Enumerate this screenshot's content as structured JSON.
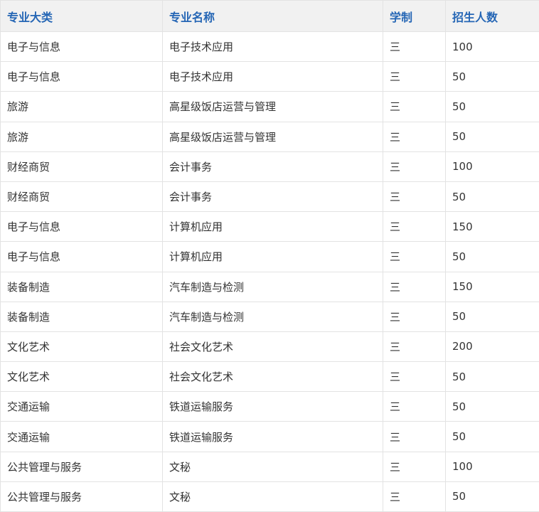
{
  "table": {
    "headers": [
      "专业大类",
      "专业名称",
      "学制",
      "招生人数"
    ],
    "rows": [
      [
        "电子与信息",
        "电子技术应用",
        "三",
        "100"
      ],
      [
        "电子与信息",
        "电子技术应用",
        "三",
        "50"
      ],
      [
        "旅游",
        "高星级饭店运营与管理",
        "三",
        "50"
      ],
      [
        "旅游",
        "高星级饭店运营与管理",
        "三",
        "50"
      ],
      [
        "财经商贸",
        "会计事务",
        "三",
        "100"
      ],
      [
        "财经商贸",
        "会计事务",
        "三",
        "50"
      ],
      [
        "电子与信息",
        "计算机应用",
        "三",
        "150"
      ],
      [
        "电子与信息",
        "计算机应用",
        "三",
        "50"
      ],
      [
        "装备制造",
        "汽车制造与检测",
        "三",
        "150"
      ],
      [
        "装备制造",
        "汽车制造与检测",
        "三",
        "50"
      ],
      [
        "文化艺术",
        "社会文化艺术",
        "三",
        "200"
      ],
      [
        "文化艺术",
        "社会文化艺术",
        "三",
        "50"
      ],
      [
        "交通运输",
        "铁道运输服务",
        "三",
        "50"
      ],
      [
        "交通运输",
        "铁道运输服务",
        "三",
        "50"
      ],
      [
        "公共管理与服务",
        "文秘",
        "三",
        "100"
      ],
      [
        "公共管理与服务",
        "文秘",
        "三",
        "50"
      ]
    ]
  },
  "colors": {
    "header_text": "#2566b5",
    "header_bg": "#f1f1f1",
    "body_text": "#333333",
    "border": "#e3e3e3"
  }
}
